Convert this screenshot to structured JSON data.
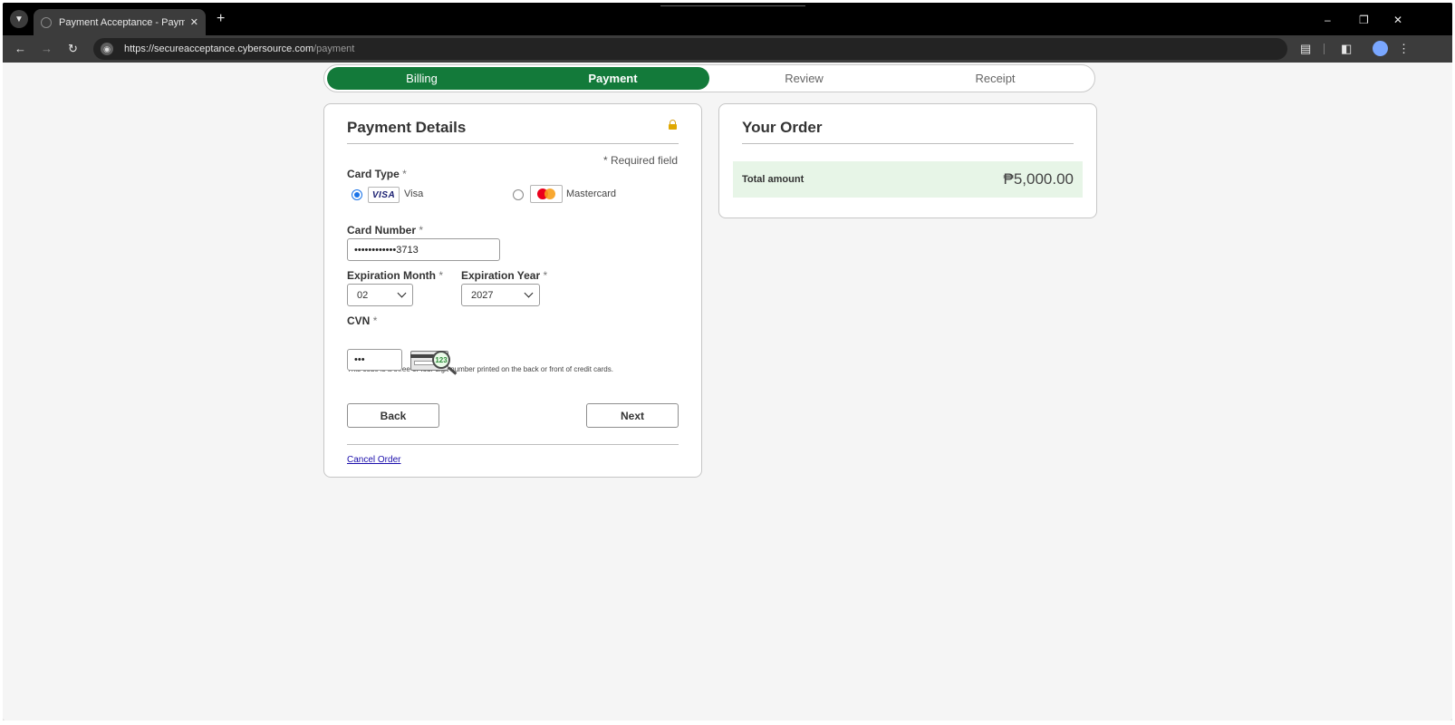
{
  "browser": {
    "tab_title": "Payment Acceptance - Payment",
    "url_host": "https://secureacceptance.cybersource.com",
    "url_path": "/payment"
  },
  "steps": [
    {
      "label": "Billing",
      "state": "done"
    },
    {
      "label": "Payment",
      "state": "current"
    },
    {
      "label": "Review",
      "state": "todo"
    },
    {
      "label": "Receipt",
      "state": "todo"
    }
  ],
  "payment": {
    "title": "Payment Details",
    "required_note": "* Required field",
    "card_type_label": "Card Type",
    "required_star": "*",
    "card_types": [
      {
        "label": "Visa",
        "logo_text": "VISA",
        "selected": true
      },
      {
        "label": "Mastercard",
        "selected": false
      }
    ],
    "card_number_label": "Card Number",
    "card_number_value": "••••••••••••3713",
    "exp_month_label": "Expiration Month",
    "exp_month_value": "02",
    "exp_year_label": "Expiration Year",
    "exp_year_value": "2027",
    "cvn_label": "CVN",
    "cvn_help": "This code is a three or four digit number printed on the back or front of credit cards.",
    "cvn_value": "•••",
    "cvn_image_number": "123",
    "back_label": "Back",
    "next_label": "Next",
    "cancel_label": "Cancel Order"
  },
  "order": {
    "title": "Your Order",
    "total_label": "Total amount",
    "total_value": "₱5,000.00"
  },
  "colors": {
    "progress_active": "#137a3a",
    "total_row_bg": "#e7f5e7",
    "link": "#1a0dab",
    "radio_selected": "#1a73e8"
  }
}
